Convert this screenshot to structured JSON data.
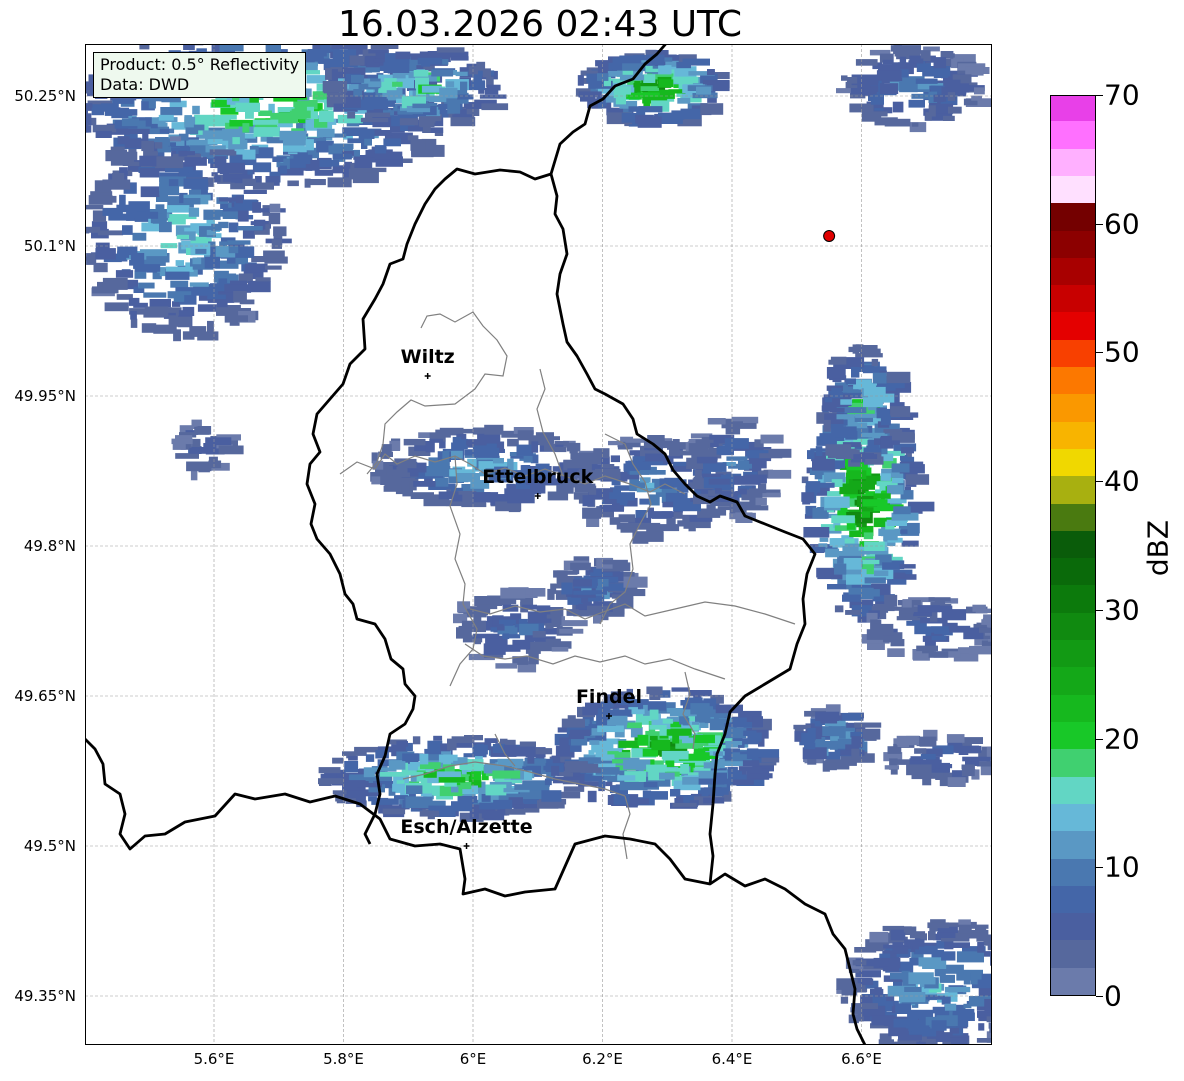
{
  "title": "16.03.2026 02:43 UTC",
  "info": {
    "product": "Product: 0.5° Reflectivity",
    "data": "Data: DWD"
  },
  "map": {
    "lon_range": [
      5.4,
      6.8
    ],
    "lat_range": [
      49.32,
      50.3
    ],
    "lat_ticks": [
      {
        "value": 50.25,
        "label": "50.25°N"
      },
      {
        "value": 50.1,
        "label": "50.1°N"
      },
      {
        "value": 49.95,
        "label": "49.95°N"
      },
      {
        "value": 49.8,
        "label": "49.8°N"
      },
      {
        "value": 49.65,
        "label": "49.65°N"
      },
      {
        "value": 49.5,
        "label": "49.5°N"
      },
      {
        "value": 49.35,
        "label": "49.35°N"
      }
    ],
    "lon_ticks": [
      {
        "value": 5.6,
        "label": "5.6°E"
      },
      {
        "value": 5.8,
        "label": "5.8°E"
      },
      {
        "value": 6.0,
        "label": "6°E"
      },
      {
        "value": 6.2,
        "label": "6.2°E"
      },
      {
        "value": 6.4,
        "label": "6.4°E"
      },
      {
        "value": 6.6,
        "label": "6.6°E"
      }
    ],
    "cities": [
      {
        "name": "Wiltz",
        "lon": 5.93,
        "lat": 49.97
      },
      {
        "name": "Ettelbruck",
        "lon": 6.1,
        "lat": 49.85
      },
      {
        "name": "Findel",
        "lon": 6.21,
        "lat": 49.63
      },
      {
        "name": "Esch/Alzette",
        "lon": 5.99,
        "lat": 49.5
      }
    ],
    "radar_site": {
      "lon": 6.55,
      "lat": 50.11,
      "color": "#e00000"
    }
  },
  "colorbar": {
    "label": "dBZ",
    "min": 0,
    "max": 70,
    "tick_labels": [
      "0",
      "10",
      "20",
      "30",
      "40",
      "50",
      "60",
      "70"
    ],
    "colors": [
      "#6b7bab",
      "#56689d",
      "#4a5fa0",
      "#4466a8",
      "#4a78b0",
      "#5a98c4",
      "#66b8d8",
      "#62d6c4",
      "#40d070",
      "#18c828",
      "#16b81e",
      "#14a818",
      "#129a14",
      "#108a10",
      "#0c7a0c",
      "#0a6a0a",
      "#0a5c0a",
      "#4a7a10",
      "#a8b010",
      "#f0d800",
      "#f8b400",
      "#fa9800",
      "#fc7800",
      "#f84000",
      "#e40000",
      "#c80000",
      "#a80000",
      "#8c0000",
      "#740000",
      "#ffe0ff",
      "#ffb0ff",
      "#ff70ff",
      "#e840e8"
    ]
  }
}
